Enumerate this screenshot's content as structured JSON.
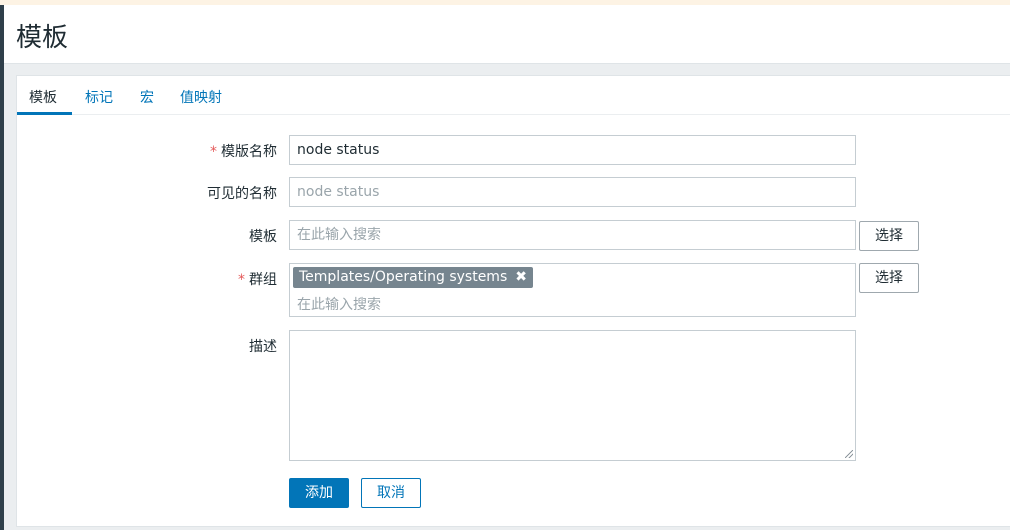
{
  "header": {
    "title": "模板"
  },
  "tabs": [
    {
      "label": "模板"
    },
    {
      "label": "标记"
    },
    {
      "label": "宏"
    },
    {
      "label": "值映射"
    }
  ],
  "form": {
    "required_mark": "*",
    "template_name": {
      "label": "模版名称",
      "value": "node status"
    },
    "visible_name": {
      "label": "可见的名称",
      "placeholder": "node status"
    },
    "templates": {
      "label": "模板",
      "placeholder": "在此输入搜索",
      "select_label": "选择"
    },
    "groups": {
      "label": "群组",
      "chips": [
        {
          "label": "Templates/Operating systems",
          "remove": "✖"
        }
      ],
      "placeholder": "在此输入搜索",
      "select_label": "选择"
    },
    "description": {
      "label": "描述",
      "value": ""
    }
  },
  "actions": {
    "add_label": "添加",
    "cancel_label": "取消"
  },
  "colors": {
    "accent": "#0275b8",
    "required": "#e45959",
    "chip_bg": "#76858f"
  }
}
